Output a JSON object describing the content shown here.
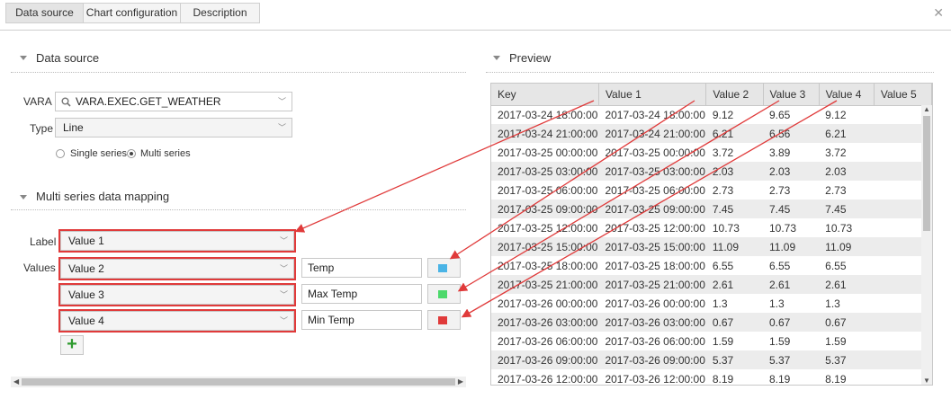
{
  "tabs": [
    {
      "label": "Data source",
      "active": true
    },
    {
      "label": "Chart configuration",
      "active": false
    },
    {
      "label": "Description",
      "active": false
    }
  ],
  "left": {
    "data_source_title": "Data source",
    "vara_label": "VARA",
    "vara_value": "VARA.EXEC.GET_WEATHER",
    "type_label": "Type",
    "type_value": "Line",
    "radio_single": "Single series",
    "radio_multi": "Multi series",
    "mapping_title": "Multi series data mapping",
    "label_label": "Label",
    "label_value": "Value 1",
    "values_label": "Values",
    "value_rows": [
      {
        "select": "Value 2",
        "name": "Temp",
        "color": "#4ab4e6"
      },
      {
        "select": "Value 3",
        "name": "Max Temp",
        "color": "#4cd96b"
      },
      {
        "select": "Value 4",
        "name": "Min Temp",
        "color": "#e03a3a"
      }
    ]
  },
  "preview": {
    "title": "Preview",
    "columns": [
      "Key",
      "Value 1",
      "Value 2",
      "Value 3",
      "Value 4",
      "Value 5"
    ],
    "rows": [
      [
        "2017-03-24 18:00:00",
        "2017-03-24 18:00:00",
        "9.12",
        "9.65",
        "9.12",
        ""
      ],
      [
        "2017-03-24 21:00:00",
        "2017-03-24 21:00:00",
        "6.21",
        "6.56",
        "6.21",
        ""
      ],
      [
        "2017-03-25 00:00:00",
        "2017-03-25 00:00:00",
        "3.72",
        "3.89",
        "3.72",
        ""
      ],
      [
        "2017-03-25 03:00:00",
        "2017-03-25 03:00:00",
        "2.03",
        "2.03",
        "2.03",
        ""
      ],
      [
        "2017-03-25 06:00:00",
        "2017-03-25 06:00:00",
        "2.73",
        "2.73",
        "2.73",
        ""
      ],
      [
        "2017-03-25 09:00:00",
        "2017-03-25 09:00:00",
        "7.45",
        "7.45",
        "7.45",
        ""
      ],
      [
        "2017-03-25 12:00:00",
        "2017-03-25 12:00:00",
        "10.73",
        "10.73",
        "10.73",
        ""
      ],
      [
        "2017-03-25 15:00:00",
        "2017-03-25 15:00:00",
        "11.09",
        "11.09",
        "11.09",
        ""
      ],
      [
        "2017-03-25 18:00:00",
        "2017-03-25 18:00:00",
        "6.55",
        "6.55",
        "6.55",
        ""
      ],
      [
        "2017-03-25 21:00:00",
        "2017-03-25 21:00:00",
        "2.61",
        "2.61",
        "2.61",
        ""
      ],
      [
        "2017-03-26 00:00:00",
        "2017-03-26 00:00:00",
        "1.3",
        "1.3",
        "1.3",
        ""
      ],
      [
        "2017-03-26 03:00:00",
        "2017-03-26 03:00:00",
        "0.67",
        "0.67",
        "0.67",
        ""
      ],
      [
        "2017-03-26 06:00:00",
        "2017-03-26 06:00:00",
        "1.59",
        "1.59",
        "1.59",
        ""
      ],
      [
        "2017-03-26 09:00:00",
        "2017-03-26 09:00:00",
        "5.37",
        "5.37",
        "5.37",
        ""
      ],
      [
        "2017-03-26 12:00:00",
        "2017-03-26 12:00:00",
        "8.19",
        "8.19",
        "8.19",
        ""
      ]
    ]
  },
  "icons": {
    "close": "close-icon",
    "search": "search-icon",
    "collapse": "collapse-triangle-icon",
    "add": "plus-icon"
  },
  "accent_highlight": "#e03a3a"
}
